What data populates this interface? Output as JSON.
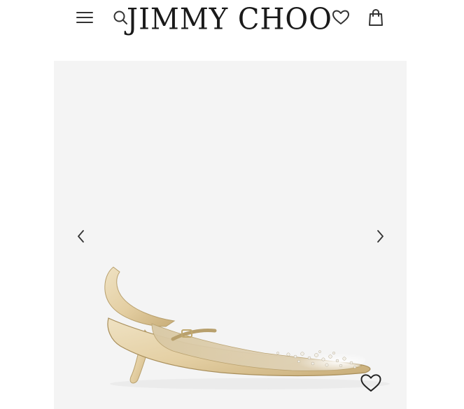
{
  "header": {
    "logo_text": "JIMMY CHOO",
    "icons": {
      "menu": "hamburger-menu-icon",
      "search": "search-icon",
      "wishlist": "heart-outline-icon",
      "bag": "shopping-bag-icon"
    }
  },
  "gallery": {
    "image_subject": "slingback-pump-product-image",
    "prev_icon": "chevron-left-icon",
    "next_icon": "chevron-right-icon",
    "favorite_icon": "heart-outline-icon",
    "background_color": "#f4f4f4"
  },
  "colors": {
    "text": "#1a1a1a",
    "gold_satin": "#e6d3ad",
    "mesh": "#d8c9a7"
  }
}
